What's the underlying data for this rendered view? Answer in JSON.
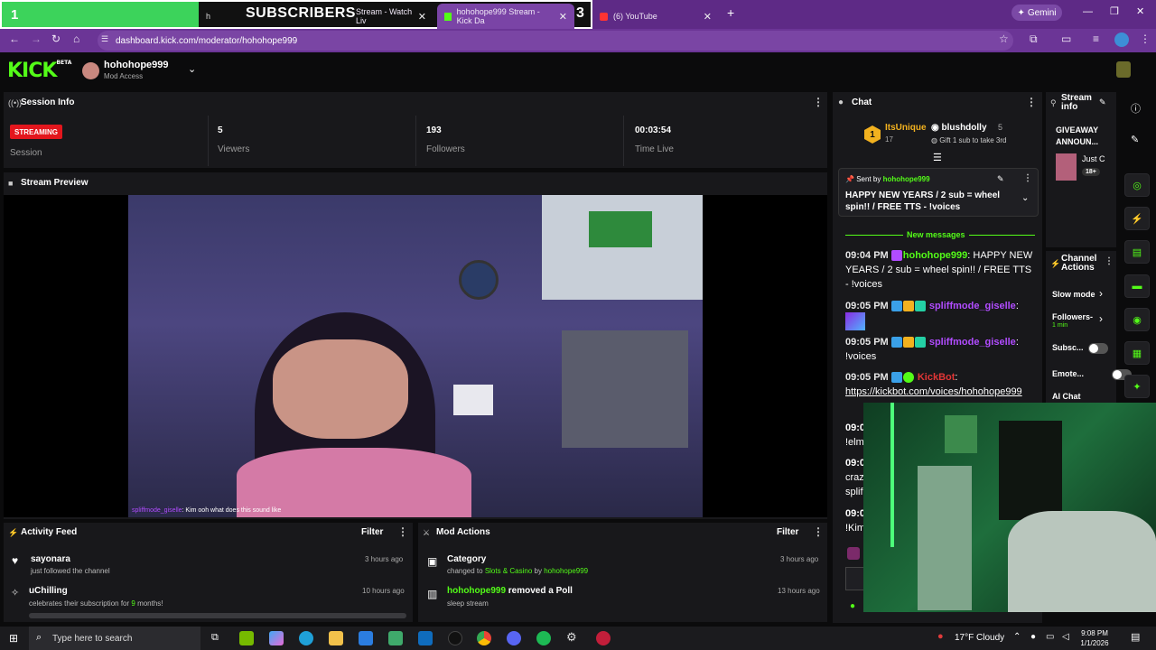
{
  "overlay": {
    "count_left": "1",
    "label": "SUBSCRIBERS",
    "count_right": "3"
  },
  "browser": {
    "tabs": [
      {
        "label": "h"
      },
      {
        "label": "Stream - Watch Liv"
      },
      {
        "label": "hohohope999 Stream - Kick Da"
      },
      {
        "label": "(6) YouTube"
      }
    ],
    "url": "dashboard.kick.com/moderator/hohohope999",
    "gemini_label": "Gemini"
  },
  "header": {
    "logo": "KICK",
    "logo_badge": "BETA",
    "username": "hohohope999",
    "access": "Mod Access"
  },
  "session": {
    "title": "Session Info",
    "status": "STREAMING",
    "status_label": "Session",
    "stats": [
      {
        "value": "5",
        "label": "Viewers"
      },
      {
        "value": "193",
        "label": "Followers"
      },
      {
        "value": "00:03:54",
        "label": "Time Live"
      }
    ]
  },
  "preview": {
    "title": "Stream Preview",
    "caption_user": "spliffmode_giselle",
    "caption_text": ": Kim ooh what does this sound like"
  },
  "activity": {
    "title": "Activity Feed",
    "filter": "Filter",
    "items": [
      {
        "name": "sayonara",
        "desc": "just followed the channel",
        "time": "3 hours ago"
      },
      {
        "name": "uChilling",
        "desc_pre": "celebrates their subscription for ",
        "desc_num": "9",
        "desc_post": " months!",
        "time": "10 hours ago"
      }
    ]
  },
  "modactions": {
    "title": "Mod Actions",
    "filter": "Filter",
    "items": [
      {
        "name": "Category",
        "desc_pre": "changed to ",
        "desc_cat": "Slots & Casino",
        "desc_by": " by ",
        "desc_user": "hohohope999",
        "time": "3 hours ago"
      },
      {
        "user": "hohohope999",
        "action": " removed a Poll",
        "desc": "sleep stream",
        "time": "13 hours ago"
      }
    ]
  },
  "chat": {
    "title": "Chat",
    "leader": {
      "rank": "1",
      "name1": "ItsUnique",
      "count1": "17",
      "name2": "blushdolly",
      "count2": "5",
      "gift": "Gift 1 sub to take 3rd"
    },
    "pinned": {
      "sent_by": "Sent by",
      "user": "hohohope999",
      "text": "HAPPY NEW YEARS / 2 sub = wheel spin!! / FREE TTS - !voices"
    },
    "new_messages": "New messages",
    "messages": [
      {
        "time": "09:04 PM",
        "user": "hohohope999",
        "text": ": HAPPY NEW YEARS / 2 sub = wheel spin!! / FREE TTS - !voices"
      },
      {
        "time": "09:05 PM",
        "user": "spliffmode_giselle",
        "text": ":"
      },
      {
        "time": "09:05 PM",
        "user": "spliffmode_giselle",
        "text": ":",
        "text2": "!voices"
      },
      {
        "time": "09:05 PM",
        "user": "KickBot",
        "text": ":",
        "link": "https://kickbot.com/voices/hohohope999"
      },
      {
        "time": "09:0",
        "text": "!elm"
      },
      {
        "time": "09:0",
        "text": "craz",
        "text2": "splif"
      },
      {
        "time": "09:0",
        "text": "!Kim"
      }
    ]
  },
  "streaminfo": {
    "title": "Stream info",
    "giveaway": "GIVEAWAY ANNOUN...",
    "sub": "Just C",
    "age": "18+"
  },
  "channelactions": {
    "title": "Channel Actions",
    "items": [
      {
        "label": "Slow mode"
      },
      {
        "label": "Followers-",
        "sub": "1 min"
      },
      {
        "label": "Subsc..."
      },
      {
        "label": "Emote..."
      },
      {
        "label": "AI Chat"
      }
    ]
  },
  "taskbar": {
    "search_placeholder": "Type here to search",
    "weather": "17°F  Cloudy",
    "time": "9:08 PM",
    "date": "1/1/2026"
  }
}
